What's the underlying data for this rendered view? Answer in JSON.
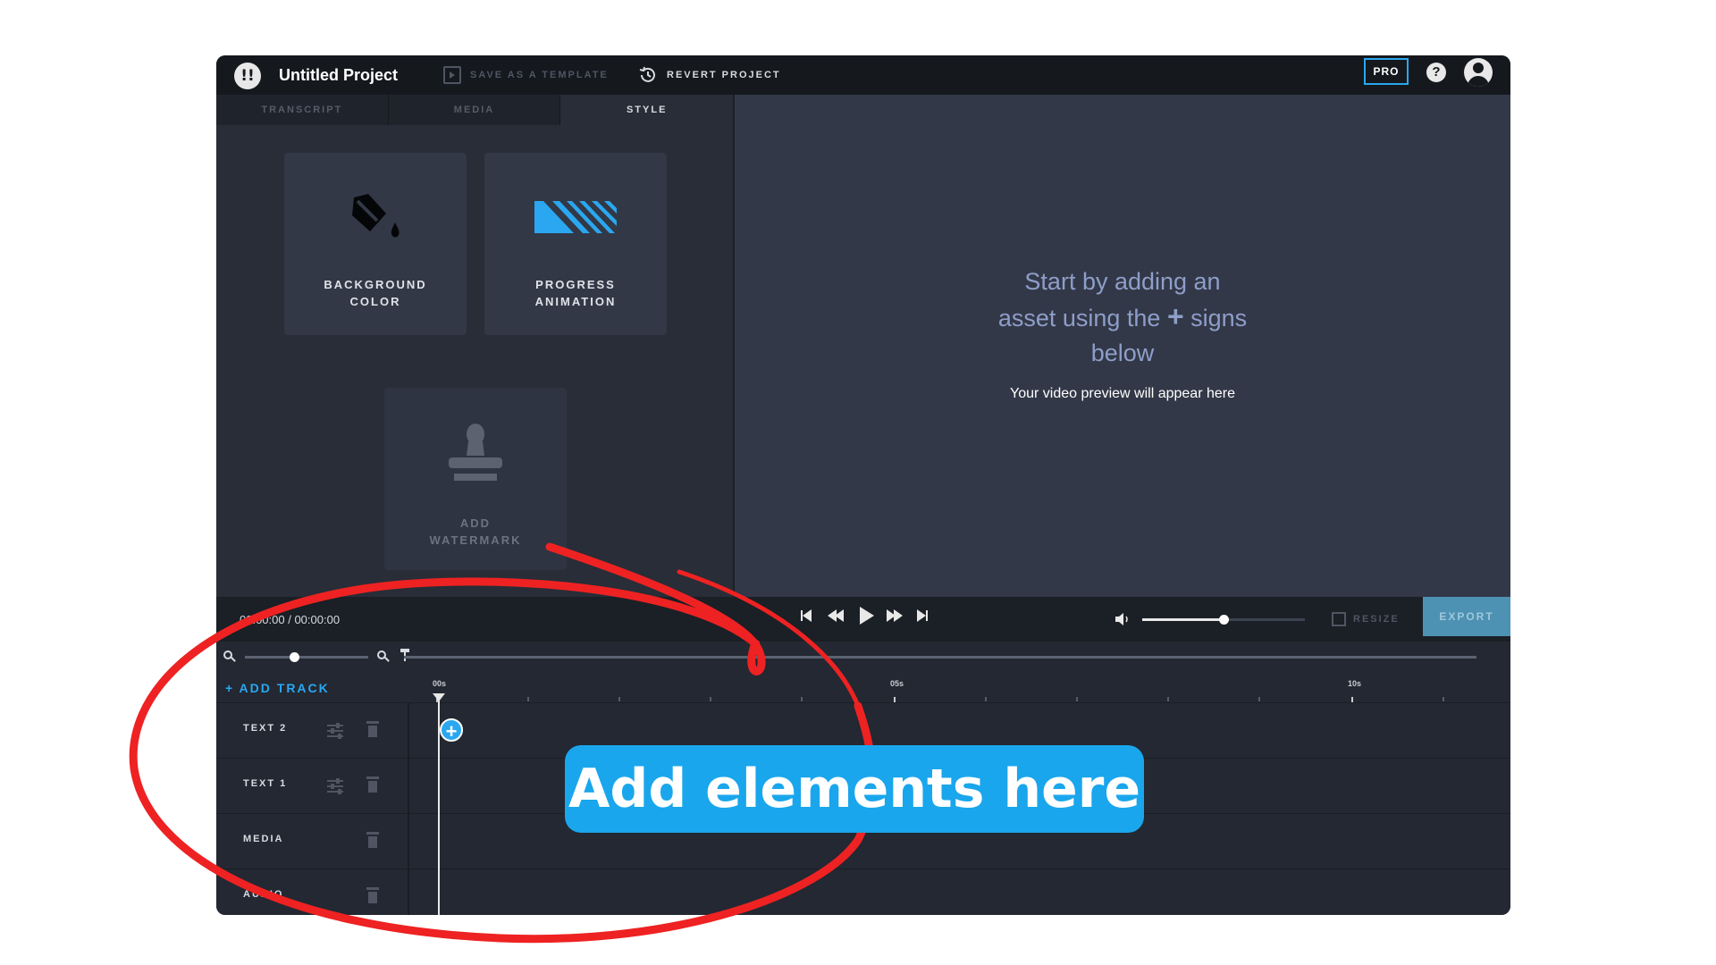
{
  "header": {
    "logo_glyph": "!!",
    "project_title": "Untitled Project",
    "save_template_label": "SAVE AS A TEMPLATE",
    "revert_label": "REVERT PROJECT",
    "pro_badge": "PRO",
    "help_glyph": "?"
  },
  "left_panel": {
    "tabs": [
      {
        "label": "TRANSCRIPT",
        "active": false
      },
      {
        "label": "MEDIA",
        "active": false
      },
      {
        "label": "STYLE",
        "active": true
      }
    ],
    "cards": [
      {
        "label_line1": "BACKGROUND",
        "label_line2": "COLOR",
        "icon": "paint-bucket-icon"
      },
      {
        "label_line1": "PROGRESS",
        "label_line2": "ANIMATION",
        "icon": "progress-stripes-icon"
      },
      {
        "label_line1": "ADD",
        "label_line2": "WATERMARK",
        "icon": "stamp-icon"
      }
    ]
  },
  "preview": {
    "hint_line1": "Start by adding an",
    "hint_line2_a": "asset using the",
    "hint_plus": "+",
    "hint_line2_b": "signs",
    "hint_line3": "below",
    "subtext": "Your video preview will appear here"
  },
  "transport": {
    "timecode": "00:00:00 / 00:00:00",
    "volume_level": 0.5,
    "resize_label": "RESIZE",
    "export_label": "EXPORT"
  },
  "zoom": {
    "level": 0.4
  },
  "timeline": {
    "add_track_label": "+ ADD TRACK",
    "ruler_labels": [
      "00s",
      "05s",
      "10s"
    ],
    "tracks": [
      {
        "label": "TEXT 2",
        "has_settings": true
      },
      {
        "label": "TEXT 1",
        "has_settings": true
      },
      {
        "label": "MEDIA",
        "has_settings": false
      },
      {
        "label": "AUDIO",
        "has_settings": false
      }
    ],
    "add_element_glyph": "+"
  },
  "annotation": {
    "callout_text": "Add elements here",
    "callout_color": "#1aa6ec",
    "circle_color": "#ee2222"
  },
  "colors": {
    "accent": "#2aa7f0",
    "export_bg": "#4d91b3"
  }
}
